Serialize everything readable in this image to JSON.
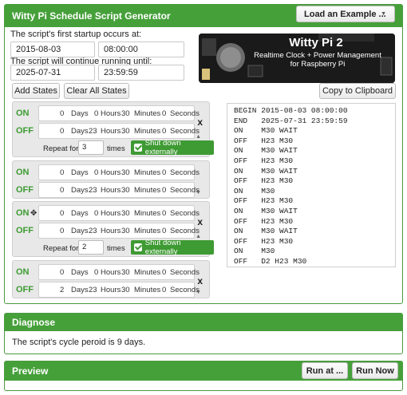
{
  "generator": {
    "title": "Witty Pi Schedule Script Generator",
    "load_example": "Load an Example ...",
    "first_startup_label": "The script's first startup occurs at:",
    "start_date": "2015-08-03",
    "start_time": "08:00:00",
    "continue_label": "The script will continue running until:",
    "end_date": "2025-07-31",
    "end_time": "23:59:59",
    "banner": {
      "title": "Witty Pi 2",
      "line1": "Realtime Clock + Power Management",
      "line2": "for Raspberry Pi"
    },
    "add_states": "Add States",
    "clear_states": "Clear All States",
    "copy": "Copy to Clipboard",
    "unit_days": "Days",
    "unit_hours": "Hours",
    "unit_minutes": "Minutes",
    "unit_seconds": "Seconds",
    "repeat_label": "Repeat for",
    "times_label": "times",
    "shutdown_label": "Shut down externally",
    "on_label": "ON",
    "off_label": "OFF",
    "remove_label": "x",
    "states": [
      {
        "on": {
          "d": "0",
          "h": "0",
          "m": "30",
          "s": "0"
        },
        "off": {
          "d": "0",
          "h": "23",
          "m": "30",
          "s": "0"
        },
        "repeat": "3"
      },
      {
        "on": {
          "d": "0",
          "h": "0",
          "m": "30",
          "s": "0"
        },
        "off": {
          "d": "0",
          "h": "23",
          "m": "30",
          "s": "0"
        }
      },
      {
        "on": {
          "d": "0",
          "h": "0",
          "m": "30",
          "s": "0"
        },
        "off": {
          "d": "0",
          "h": "23",
          "m": "30",
          "s": "0"
        },
        "repeat": "2"
      },
      {
        "on": {
          "d": "0",
          "h": "0",
          "m": "30",
          "s": "0"
        },
        "off": {
          "d": "2",
          "h": "23",
          "m": "30",
          "s": "0"
        }
      }
    ],
    "script_lines": [
      "BEGIN 2015-08-03 08:00:00",
      "END   2025-07-31 23:59:59",
      "ON    M30 WAIT",
      "OFF   H23 M30",
      "ON    M30 WAIT",
      "OFF   H23 M30",
      "ON    M30 WAIT",
      "OFF   H23 M30",
      "ON    M30",
      "OFF   H23 M30",
      "ON    M30 WAIT",
      "OFF   H23 M30",
      "ON    M30 WAIT",
      "OFF   H23 M30",
      "ON    M30",
      "OFF   D2 H23 M30"
    ]
  },
  "diagnose": {
    "title": "Diagnose",
    "message": "The script's cycle peroid is 9 days."
  },
  "preview": {
    "title": "Preview",
    "run_at": "Run at ...",
    "run_now": "Run Now"
  },
  "colors": {
    "accent": "#46a03a",
    "on_green": "#3d9b32"
  }
}
